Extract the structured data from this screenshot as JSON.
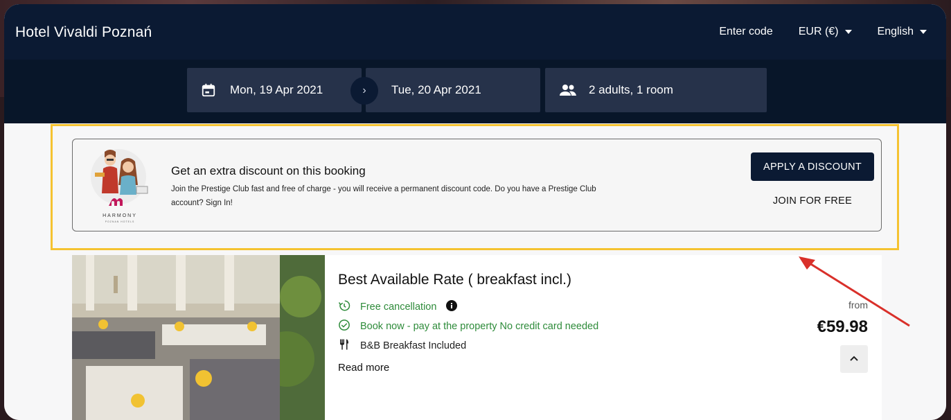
{
  "header": {
    "hotel_name": "Hotel Vivaldi Poznań",
    "enter_code": "Enter code",
    "currency": "EUR (€)",
    "language": "English"
  },
  "search": {
    "checkin": "Mon, 19 Apr 2021",
    "checkout": "Tue, 20 Apr 2021",
    "guests": "2 adults, 1 room"
  },
  "promo": {
    "logo_text": "HARMONY",
    "logo_subtext": "POZNAN HOTELS",
    "title": "Get an extra discount on this booking",
    "text": "Join the Prestige Club fast and free of charge - you will receive a permanent discount code. Do you have a Prestige Club account? Sign In!",
    "apply_button": "APPLY A DISCOUNT",
    "join_button": "JOIN FOR FREE"
  },
  "room": {
    "title": "Best Available Rate ( breakfast incl.)",
    "features": [
      {
        "label": "Free cancellation",
        "icon": "history-icon",
        "info": true
      },
      {
        "label": "Book now - pay at the property No credit card needed",
        "icon": "check-circle-icon"
      },
      {
        "label": "B&B Breakfast Included",
        "icon": "fork-knife-icon"
      }
    ],
    "read_more": "Read more",
    "price_prefix": "from",
    "price": "€59.98"
  },
  "colors": {
    "navy": "#0b1a33",
    "search_box": "#26324a",
    "highlight": "#f5c331",
    "green": "#2e8b3a",
    "arrow": "#d9302a"
  }
}
